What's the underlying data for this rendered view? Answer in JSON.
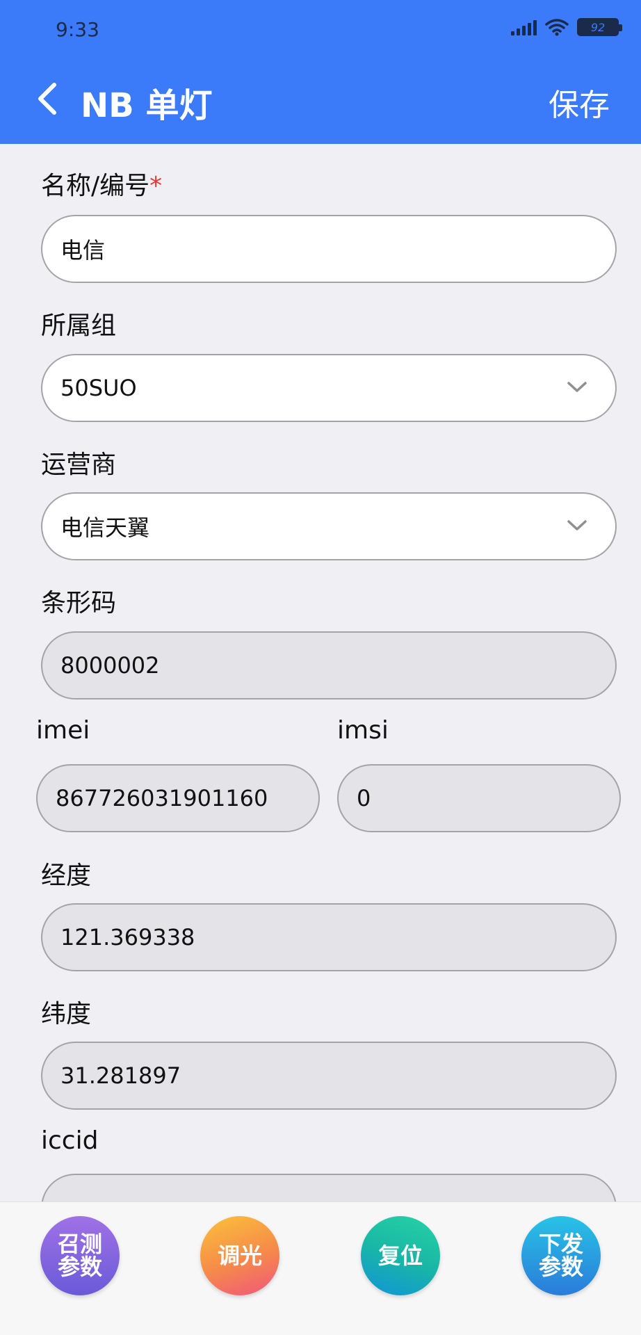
{
  "status_bar": {
    "time": "9:33",
    "battery": "92"
  },
  "header": {
    "title": "NB 单灯",
    "save_label": "保存"
  },
  "form": {
    "name": {
      "label": "名称/编号",
      "required_mark": "*",
      "value": "电信"
    },
    "group": {
      "label": "所属组",
      "value": "50SUO"
    },
    "carrier": {
      "label": "运营商",
      "value": "电信天翼"
    },
    "barcode": {
      "label": "条形码",
      "value": "8000002"
    },
    "imei": {
      "label": "imei",
      "value": "867726031901160"
    },
    "imsi": {
      "label": "imsi",
      "value": "0"
    },
    "longitude": {
      "label": "经度",
      "value": "121.369338"
    },
    "latitude": {
      "label": "纬度",
      "value": "31.281897"
    },
    "iccid": {
      "label": "iccid",
      "value": ""
    }
  },
  "actions": {
    "query_params": {
      "line1": "召测",
      "line2": "参数"
    },
    "dimming": {
      "label": "调光"
    },
    "reset": {
      "label": "复位"
    },
    "send_params": {
      "line1": "下发",
      "line2": "参数"
    }
  },
  "colors": {
    "primary": "#3b7af8",
    "required": "#e53935"
  }
}
